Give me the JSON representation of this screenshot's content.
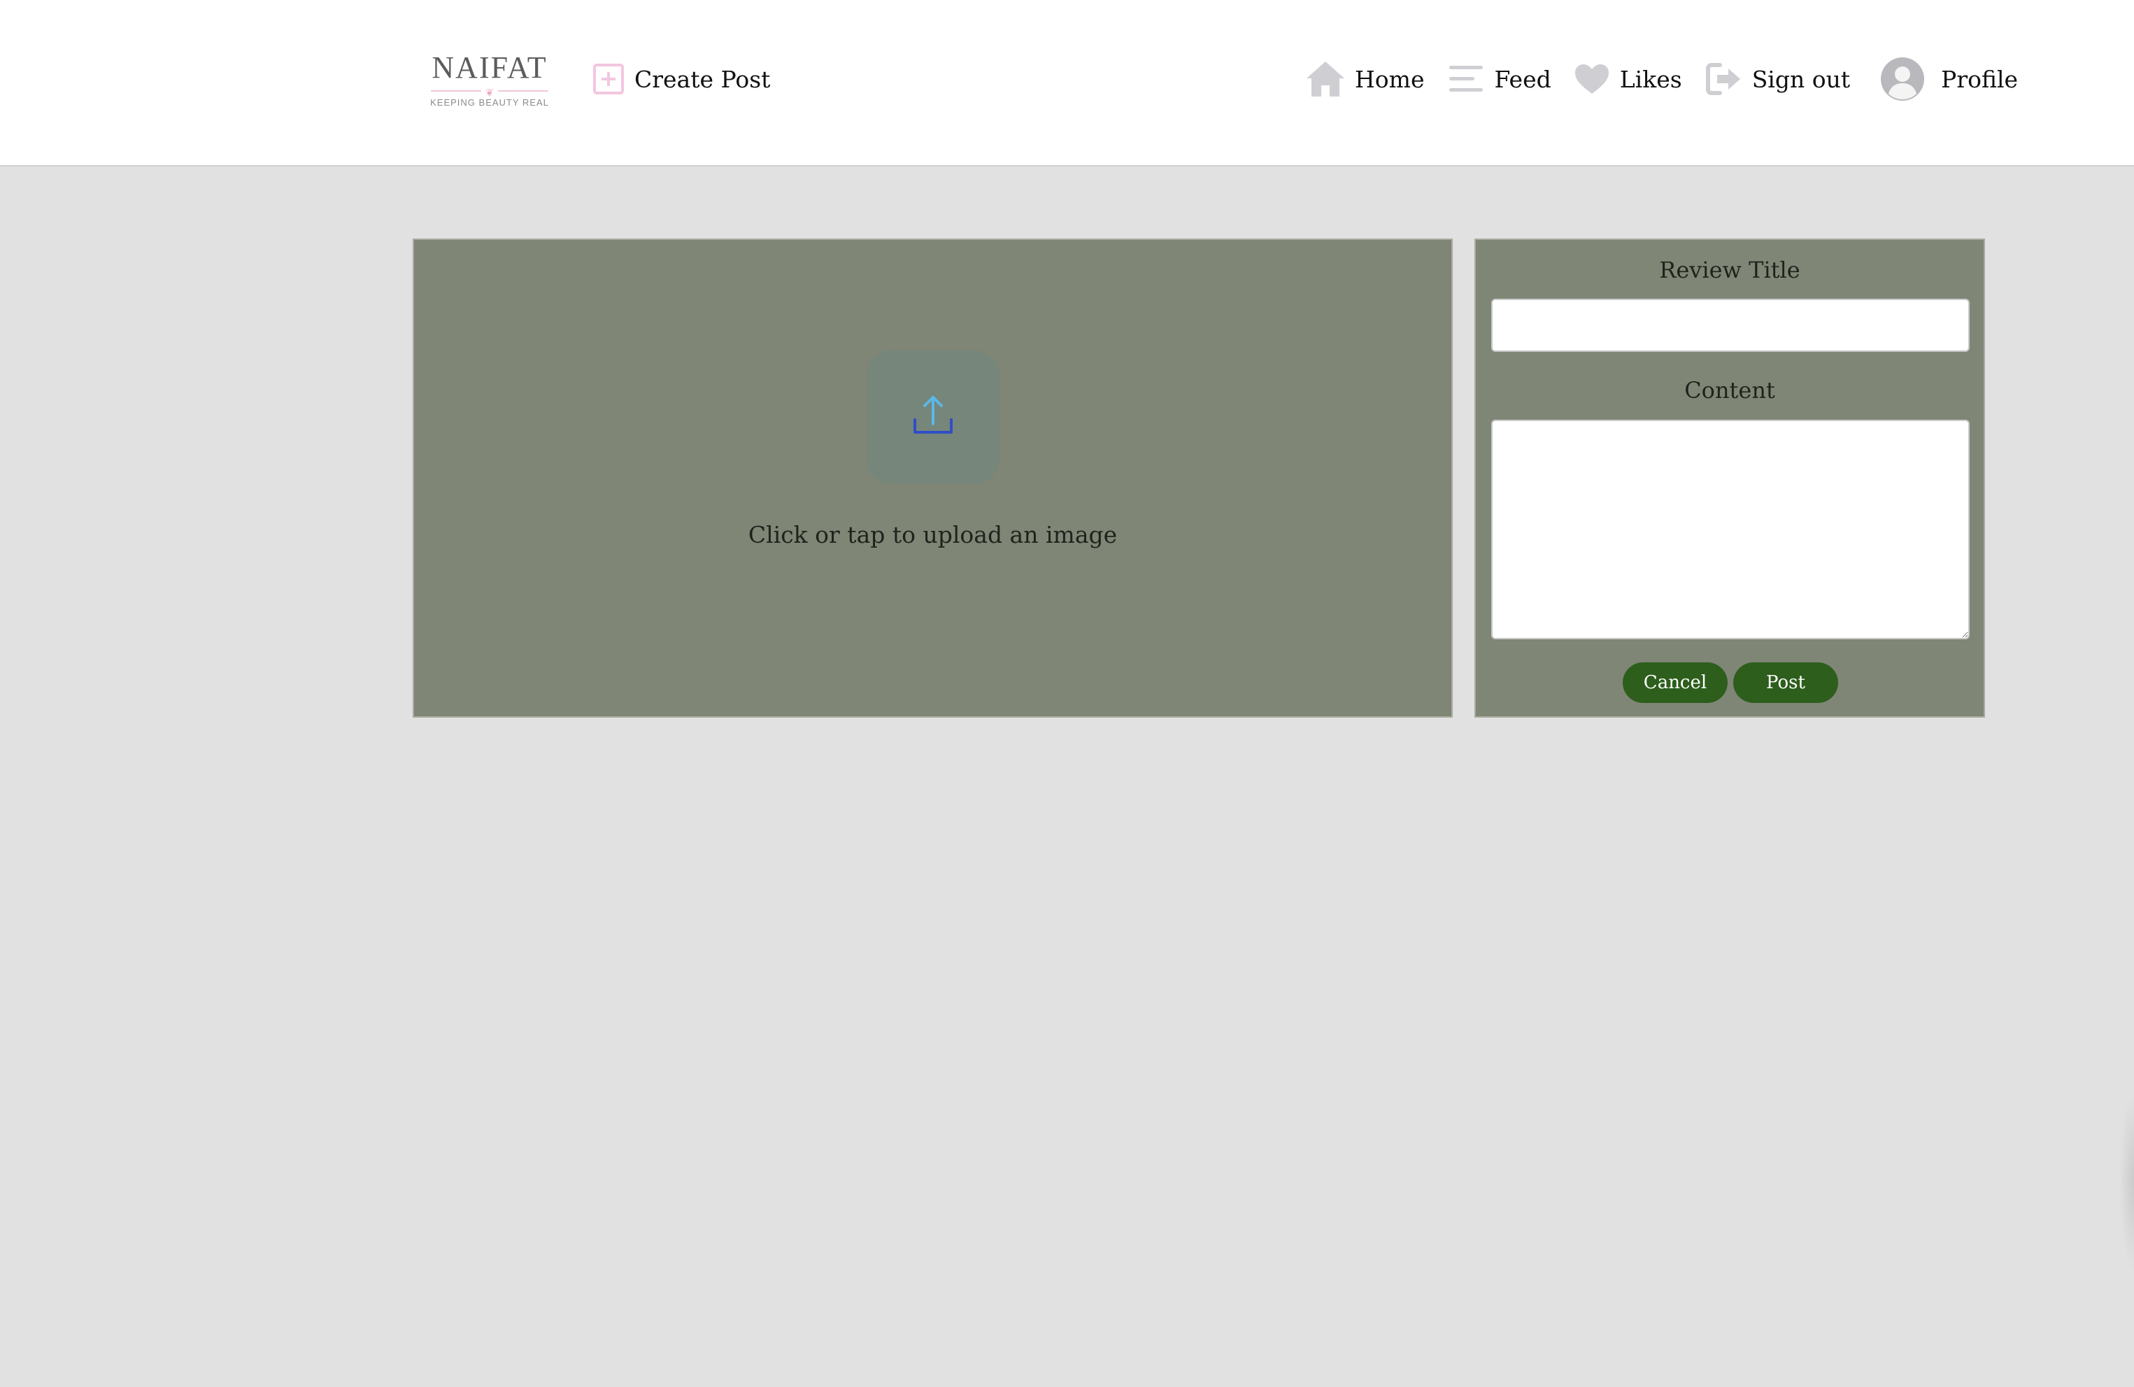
{
  "brand": {
    "name": "NAIFAT",
    "emblem": "❦",
    "tagline": "KEEPING BEAUTY REAL"
  },
  "header": {
    "create_post": {
      "label": "Create Post",
      "icon": "plus-square-icon"
    },
    "nav": [
      {
        "label": "Home",
        "icon": "home-icon"
      },
      {
        "label": "Feed",
        "icon": "feed-lines-icon"
      },
      {
        "label": "Likes",
        "icon": "heart-icon"
      },
      {
        "label": "Sign out",
        "icon": "sign-out-icon"
      },
      {
        "label": "Profile",
        "icon": "avatar-icon"
      }
    ]
  },
  "upload": {
    "icon": "upload-icon",
    "prompt": "Click or tap to upload an image"
  },
  "form": {
    "title_label": "Review Title",
    "title_value": "",
    "content_label": "Content",
    "content_value": "",
    "cancel_label": "Cancel",
    "post_label": "Post"
  },
  "colors": {
    "page_background": "#e1e1e1",
    "panel_background": "#7f8676",
    "button_green": "#2d5e1c",
    "accent_pink": "#f3c6d8",
    "nav_icon_gray": "#cfcfd3"
  }
}
